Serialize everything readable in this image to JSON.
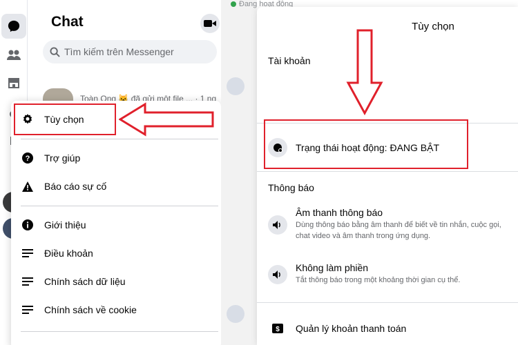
{
  "left": {
    "chat_title": "Chat",
    "search_placeholder": "Tìm kiếm trên Messenger",
    "conversation": {
      "name": "Toàn Ong",
      "emoji": "🐱",
      "snippet": "đã gửi một file ...",
      "time": "· 1 ng"
    },
    "menu": {
      "items": [
        {
          "label": "Tùy chọn",
          "icon": "gear-icon"
        },
        {
          "label": "Trợ giúp",
          "icon": "help-icon"
        },
        {
          "label": "Báo cáo sự cố",
          "icon": "warning-icon"
        },
        {
          "label": "Giới thiệu",
          "icon": "info-icon"
        },
        {
          "label": "Điều khoản",
          "icon": "document-icon"
        },
        {
          "label": "Chính sách dữ liệu",
          "icon": "document-icon"
        },
        {
          "label": "Chính sách về cookie",
          "icon": "document-icon"
        }
      ]
    }
  },
  "middle": {
    "faded_text": "Đang hoạt động"
  },
  "right": {
    "title": "Tùy chọn",
    "account_section": "Tài khoản",
    "active_status": "Trạng thái hoạt động: ĐANG BẬT",
    "notifications_section": "Thông báo",
    "sound": {
      "label": "Âm thanh thông báo",
      "sub_1": "Dùng thông báo bằng âm thanh để biết về tin nhắn, cuộc gọi,",
      "sub_2": "chat video và âm thanh trong ứng dụng."
    },
    "dnd": {
      "label": "Không làm phiền",
      "sub": "Tắt thông báo trong một khoảng thời gian cụ thể."
    },
    "payments": "Quản lý khoản thanh toán"
  },
  "annotation_color": "#e0202b"
}
